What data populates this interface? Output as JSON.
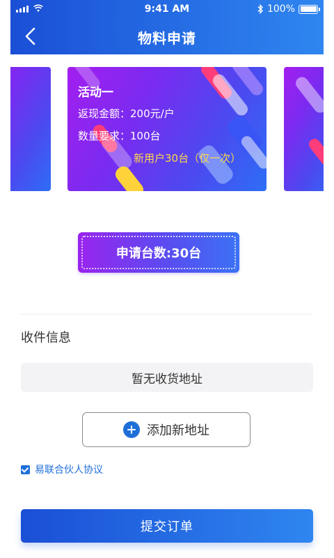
{
  "status_bar": {
    "time": "9:41 AM",
    "battery": "100%"
  },
  "nav": {
    "title": "物料申请"
  },
  "activity": {
    "name": "活动一",
    "cashback_label": "返现金额：",
    "cashback_value": "200元/户",
    "quantity_label": "数量要求：",
    "quantity_value": "100台",
    "note": "新用户30台（仅一次）"
  },
  "apply_count": "申请台数:30台",
  "shipping": {
    "section_title": "收件信息",
    "empty_text": "暂无收货地址",
    "add_button": "添加新地址"
  },
  "agreement": {
    "label": "易联合伙人协议",
    "checked": true
  },
  "submit_label": "提交订单",
  "colors": {
    "primary": "#1f6fd8",
    "note": "#ffd84a"
  }
}
